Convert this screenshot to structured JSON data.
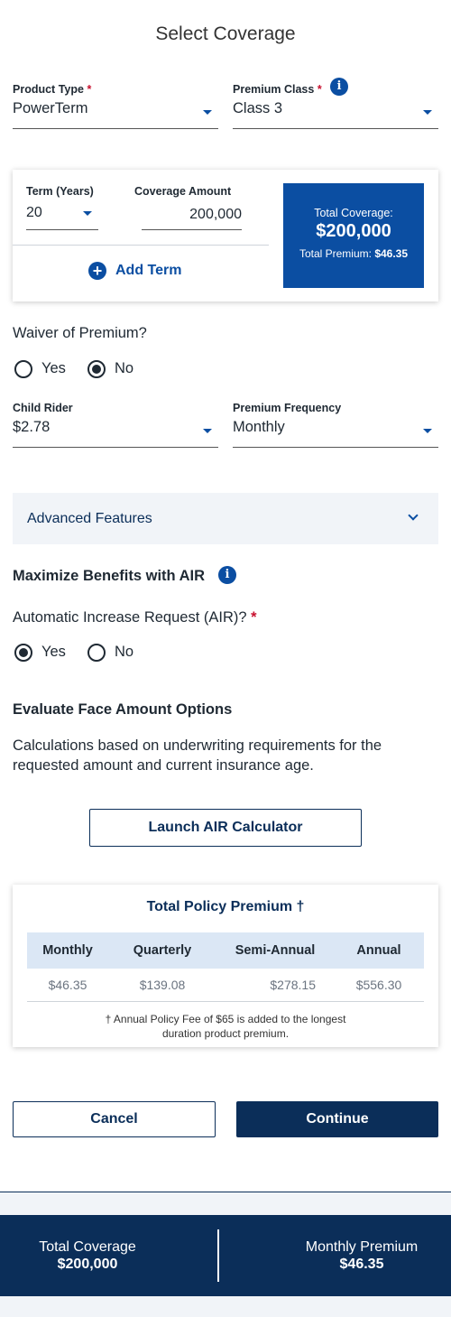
{
  "page": {
    "title": "Select Coverage"
  },
  "product_type": {
    "label": "Product Type",
    "required": "*",
    "value": "PowerTerm"
  },
  "premium_class": {
    "label": "Premium Class",
    "required": "*",
    "value": "Class 3",
    "info_icon": "i"
  },
  "coverage_card": {
    "term_label": "Term (Years)",
    "term_value": "20",
    "amount_label": "Coverage Amount",
    "amount_value": "200,000",
    "add_term_label": "Add Term",
    "add_icon": "+",
    "total_coverage_label": "Total Coverage:",
    "total_coverage_value": "$200,000",
    "total_premium_label": "Total Premium:",
    "total_premium_value": "$46.35"
  },
  "waiver": {
    "question": "Waiver of Premium?",
    "options": [
      "Yes",
      "No"
    ],
    "selected": "No"
  },
  "child_rider": {
    "label": "Child Rider",
    "value": "$2.78"
  },
  "premium_frequency": {
    "label": "Premium Frequency",
    "value": "Monthly"
  },
  "advanced": {
    "label": "Advanced Features"
  },
  "air": {
    "heading": "Maximize Benefits with AIR",
    "info_icon": "i",
    "question": "Automatic Increase Request (AIR)?",
    "required": "*",
    "options": [
      "Yes",
      "No"
    ],
    "selected": "Yes"
  },
  "evaluate": {
    "heading": "Evaluate Face Amount Options",
    "line1": "Calculations based on underwriting requirements for the",
    "line2": "requested amount and current insurance age.",
    "button": "Launch AIR Calculator"
  },
  "policy_premium": {
    "title": "Total Policy Premium †",
    "headers": [
      "Monthly",
      "Quarterly",
      "Semi-Annual",
      "Annual"
    ],
    "values": [
      "$46.35",
      "$139.08",
      "$278.15",
      "$556.30"
    ],
    "note_line1": "† Annual Policy Fee of $65 is added to the longest",
    "note_line2": "duration product premium."
  },
  "actions": {
    "cancel": "Cancel",
    "continue": "Continue"
  },
  "footer": {
    "coverage_label": "Total Coverage",
    "coverage_value": "$200,000",
    "premium_label": "Monthly Premium",
    "premium_value": "$46.35"
  },
  "colors": {
    "brand_blue": "#0b4ea2",
    "navy": "#0b2e59",
    "required_red": "#c8102e"
  }
}
